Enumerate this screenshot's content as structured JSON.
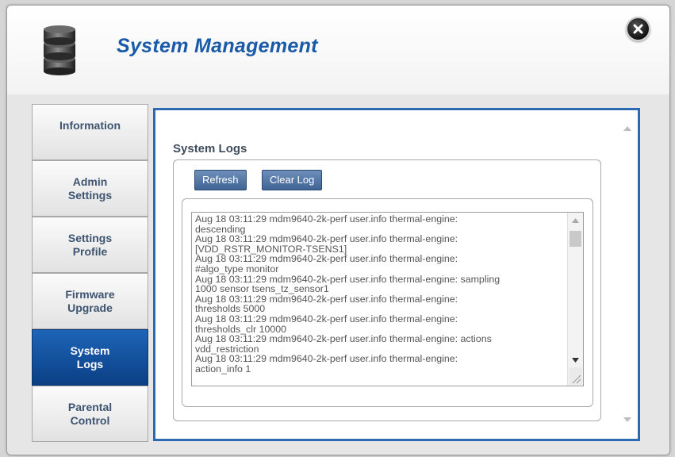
{
  "window": {
    "title": "System Management",
    "icons": {
      "app": "database-icon",
      "close": "close-icon"
    }
  },
  "sidebar": {
    "items": [
      {
        "label": "Information",
        "active": false
      },
      {
        "label": "Admin\nSettings",
        "active": false
      },
      {
        "label": "Settings\nProfile",
        "active": false
      },
      {
        "label": "Firmware\nUpgrade",
        "active": false
      },
      {
        "label": "System\nLogs",
        "active": true
      },
      {
        "label": "Parental\nControl",
        "active": false
      }
    ]
  },
  "content": {
    "section_title": "System Logs",
    "buttons": {
      "refresh": "Refresh",
      "clear": "Clear Log"
    },
    "log_text": "Aug 18 03:11:29 mdm9640-2k-perf user.info thermal-engine:\ndescending\nAug 18 03:11:29 mdm9640-2k-perf user.info thermal-engine:\n[VDD_RSTR_MONITOR-TSENS1]\nAug 18 03:11:29 mdm9640-2k-perf user.info thermal-engine:\n#algo_type monitor\nAug 18 03:11:29 mdm9640-2k-perf user.info thermal-engine: sampling\n1000 sensor tsens_tz_sensor1\nAug 18 03:11:29 mdm9640-2k-perf user.info thermal-engine:\nthresholds 5000\nAug 18 03:11:29 mdm9640-2k-perf user.info thermal-engine:\nthresholds_clr 10000\nAug 18 03:11:29 mdm9640-2k-perf user.info thermal-engine: actions\nvdd_restriction\nAug 18 03:11:29 mdm9640-2k-perf user.info thermal-engine:\naction_info 1"
  },
  "colors": {
    "title": "#1a5aa8",
    "active_tab": "#0b3f84",
    "content_border": "#2c6ab3",
    "button": "#4a6f9f"
  }
}
